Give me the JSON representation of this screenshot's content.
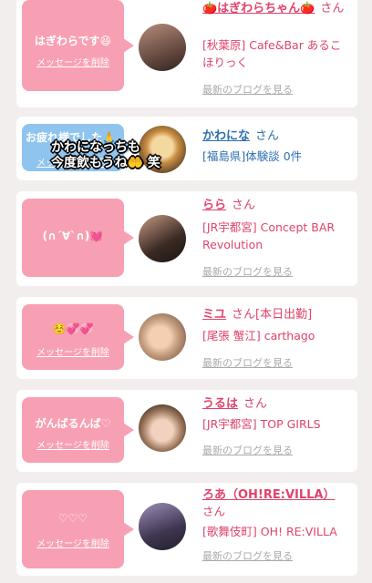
{
  "delete_label": "メッセージを削除",
  "blog_label": "最新のブログを見る",
  "san_label": "さん",
  "cards": [
    {
      "message": "はぎわらです😆",
      "name": "🍅はぎわらちゃん🍅",
      "info": "[秋葉原] Cafe&Bar あるこほりっく",
      "name_color": "#e0436a"
    },
    {
      "message": "お疲れ様でした🙏",
      "name": "かわにな",
      "info": "[福島県]体験談 0件",
      "overlay": [
        "かわになっちも",
        "今度飲もうね🤲 笑"
      ],
      "name_color": "#2c6fb0"
    },
    {
      "message": "(∩´∀`∩)💓",
      "name": "らら",
      "info": "[JR宇都宮] Concept BAR Revolution"
    },
    {
      "message": "☺️💞💞",
      "name": "ミユ",
      "extra": "[本日出勤]",
      "info": "[尾張 蟹江] carthago"
    },
    {
      "message": "がんばるんば♡",
      "name": "うるは",
      "info": "[JR宇都宮] TOP GIRLS"
    },
    {
      "message": "♡♡♡",
      "name": "ろあ（OH!RE:VILLA）",
      "info": "[歌舞伎町] OH! RE:VILLA"
    }
  ],
  "colors": {
    "pink_bubble": "#f8a0b3",
    "blue_bubble": "#8fc4ee",
    "accent": "#e0436a"
  }
}
